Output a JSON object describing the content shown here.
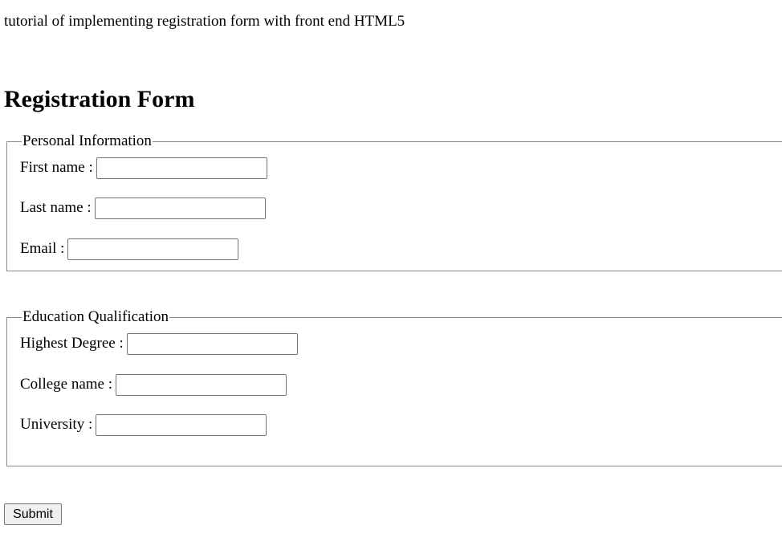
{
  "intro_text": "tutorial of implementing registration form with front end HTML5",
  "heading": "Registration Form",
  "personal": {
    "legend": "Personal Information",
    "first_name_label": "First name :",
    "first_name_value": "",
    "last_name_label": "Last name :",
    "last_name_value": "",
    "email_label": "Email :",
    "email_value": ""
  },
  "education": {
    "legend": "Education Qualification",
    "degree_label": "Highest Degree :",
    "degree_value": "",
    "college_label": "College name :",
    "college_value": "",
    "university_label": "University :",
    "university_value": ""
  },
  "submit_label": "Submit"
}
